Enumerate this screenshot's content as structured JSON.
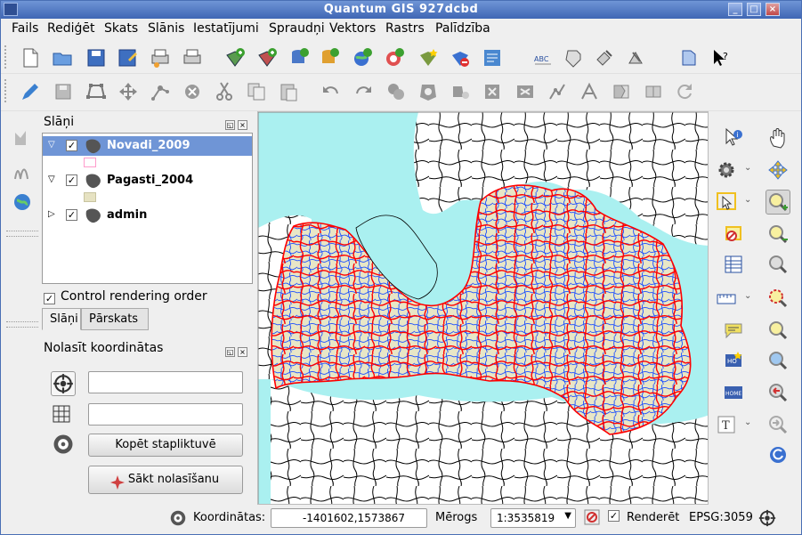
{
  "window": {
    "title": "Quantum GIS 927dcbd"
  },
  "menu": [
    "Fails",
    "Rediģēt",
    "Skats",
    "Slānis",
    "Iestatījumi",
    "Spraudņi",
    "Vektors",
    "Rastrs",
    "Palīdzība"
  ],
  "toolbar1": [
    "new-project-icon",
    "open-project-icon",
    "save-project-icon",
    "save-as-icon",
    "print-composer-icon",
    "print-icon",
    "add-vector-layer-icon",
    "add-raster-layer-icon",
    "add-postgis-layer-icon",
    "add-spatialite-layer-icon",
    "add-wms-layer-icon",
    "add-wfs-layer-icon",
    "new-shapefile-icon",
    "remove-layer-icon",
    "add-delimited-text-icon",
    "label-icon",
    "pin-icon",
    "plugin-icon",
    "help-book-icon",
    "whats-this-icon"
  ],
  "toolbar2": [
    "edit-pencil-icon",
    "save-edits-icon",
    "add-polygon-icon",
    "move-feature-icon",
    "node-tool-icon",
    "delete-selected-icon",
    "cut-icon",
    "copy-icon",
    "paste-icon",
    "undo-icon",
    "redo-icon",
    "simplify-icon",
    "add-ring-icon",
    "add-part-icon",
    "delete-ring-icon",
    "delete-part-icon",
    "reshape-icon",
    "split-icon",
    "merge-icon",
    "merge-attributes-icon",
    "rotate-icon"
  ],
  "left_tools": [
    "left-tool-1-icon",
    "left-tool-2-icon",
    "left-globe-icon"
  ],
  "layers_panel": {
    "title": "Slāņi",
    "layers": [
      {
        "name": "Novadi_2009",
        "checked": "✓",
        "expanded": "▽",
        "selected": true,
        "swatch": "#ff9ccc"
      },
      {
        "name": "Pagasti_2004",
        "checked": "✓",
        "expanded": "▽",
        "selected": false,
        "swatch": "#e6e2c2"
      },
      {
        "name": "admin",
        "checked": "✓",
        "expanded": "▷",
        "selected": false,
        "swatch": ""
      }
    ],
    "control_rendering": {
      "label": "Control rendering order",
      "checked": "✓"
    },
    "tabs": [
      "Slāņi",
      "Pārskats"
    ]
  },
  "coords_panel": {
    "title": "Nolasīt koordinātas",
    "field1_value": "",
    "field2_value": "",
    "copy_button": "Kopēt stapliktuvē",
    "start_button": "Sākt nolasīšanu"
  },
  "right_tools": [
    "identify-icon",
    "pan-icon",
    "gear-icon",
    "pan-to-selection-icon",
    "select-icon",
    "zoom-in-icon",
    "deselect-icon",
    "zoom-out-icon",
    "attribute-table-icon",
    "zoom-full-icon",
    "measure-icon",
    "zoom-to-selection-icon",
    "annotation-icon",
    "zoom-to-layer-icon",
    "map-tips-icon",
    "zoom-native-icon",
    "new-bookmark-icon",
    "zoom-last-icon",
    "show-bookmarks-icon",
    "zoom-next-icon",
    "text-annotation-icon",
    "refresh-icon"
  ],
  "status": {
    "coords_label": "Koordinātas:",
    "coords_value": "-1401602,1573867",
    "scale_label": "Mērogs",
    "scale_value": "1:3535819",
    "render_label": "Renderēt",
    "render_checked": "✓",
    "epsg": "EPSG:3059"
  },
  "colors": {
    "title_bar": "#3f66b4",
    "map_sea": "#aaf0f0",
    "map_land": "#e8e6c6",
    "novadi_outline": "#ff0000",
    "pagasti_outline": "#0044ff",
    "admin_outline": "#000000",
    "selected_layer": "#6f95d6"
  }
}
